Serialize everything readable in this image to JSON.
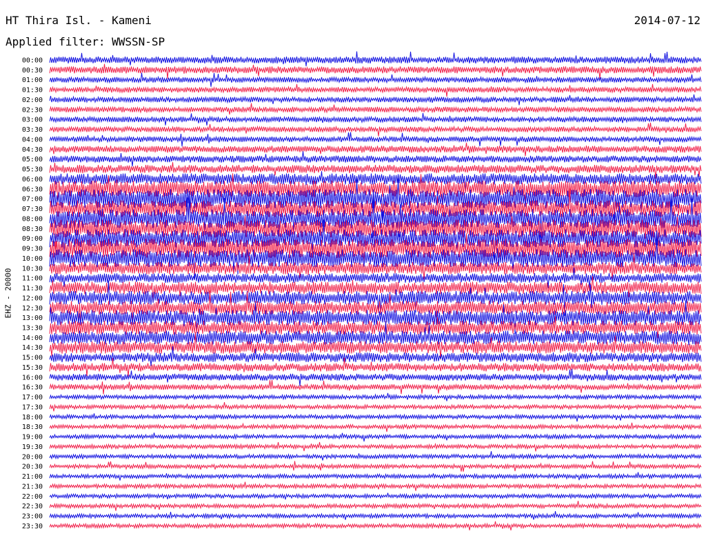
{
  "header": {
    "title": "HT Thira Isl. - Kameni",
    "date": "2014-07-12",
    "filter": "Applied filter: WWSSN-SP"
  },
  "chart_data": {
    "type": "line",
    "channel_label": "EHZ - 20000",
    "row_labels": [
      "00:00",
      "00:30",
      "01:00",
      "01:30",
      "02:00",
      "02:30",
      "03:00",
      "03:30",
      "04:00",
      "04:30",
      "05:00",
      "05:30",
      "06:00",
      "06:30",
      "07:00",
      "07:30",
      "08:00",
      "08:30",
      "09:00",
      "09:30",
      "10:00",
      "10:30",
      "11:00",
      "11:30",
      "12:00",
      "12:30",
      "13:00",
      "13:30",
      "14:00",
      "14:30",
      "15:00",
      "15:30",
      "16:00",
      "16:30",
      "17:00",
      "17:30",
      "18:00",
      "18:30",
      "19:00",
      "19:30",
      "20:00",
      "20:30",
      "21:00",
      "21:30",
      "22:00",
      "22:30",
      "23:00",
      "23:30"
    ],
    "colors": [
      "#1010e0",
      "#f0204a"
    ],
    "noise_level": [
      5,
      5,
      4,
      4,
      4,
      4,
      4,
      4,
      4,
      5,
      5,
      6,
      8,
      12,
      14,
      12,
      14,
      13,
      13,
      14,
      13,
      9,
      7,
      9,
      10,
      10,
      11,
      10,
      10,
      9,
      7,
      6,
      5,
      4,
      3,
      3,
      3,
      3,
      3,
      3,
      3,
      3,
      3,
      3,
      3,
      3,
      3,
      3
    ]
  }
}
